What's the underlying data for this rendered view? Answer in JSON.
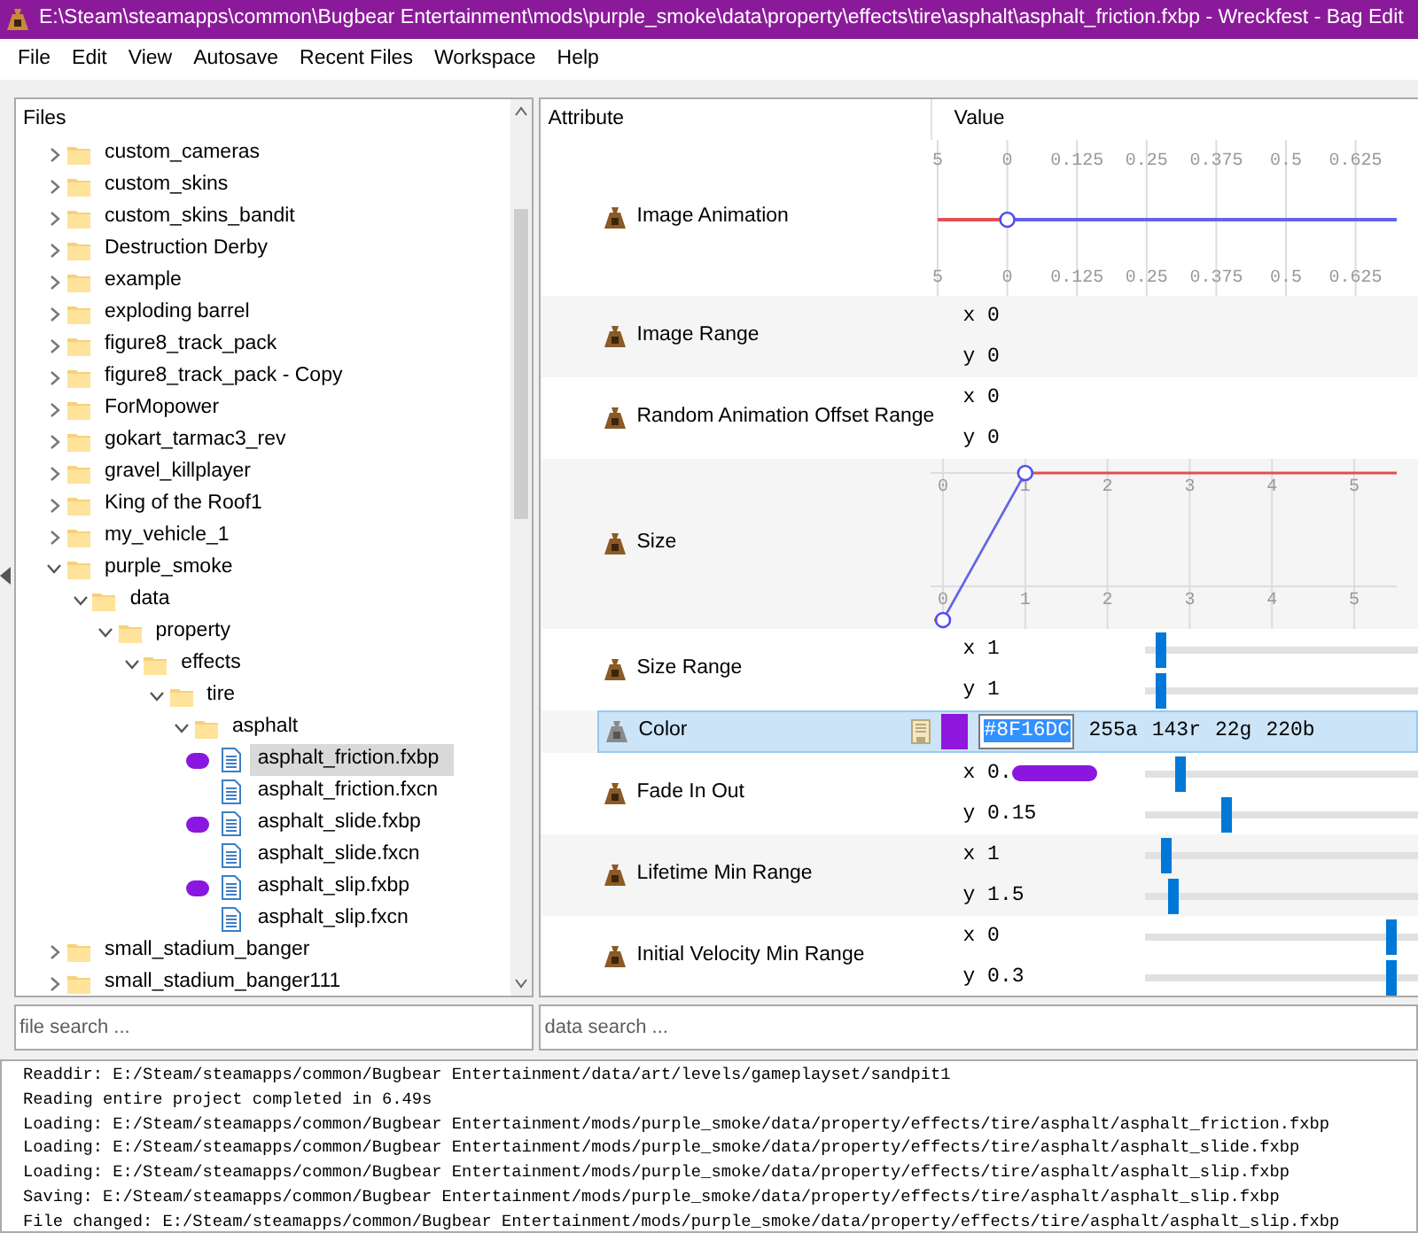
{
  "window": {
    "title": "E:\\Steam\\steamapps\\common\\Bugbear Entertainment\\mods\\purple_smoke\\data\\property\\effects\\tire\\asphalt\\asphalt_friction.fxbp - Wreckfest - Bag Edit"
  },
  "menu": [
    "File",
    "Edit",
    "View",
    "Autosave",
    "Recent Files",
    "Workspace",
    "Help"
  ],
  "files": {
    "heading": "Files",
    "search": {
      "placeholder": "file search ..."
    },
    "tree": [
      {
        "name": "custom_cameras",
        "kind": "folder",
        "expanded": false,
        "selected": false
      },
      {
        "name": "custom_skins",
        "kind": "folder",
        "expanded": false,
        "selected": false
      },
      {
        "name": "custom_skins_bandit",
        "kind": "folder",
        "expanded": false,
        "selected": false
      },
      {
        "name": "Destruction Derby",
        "kind": "folder",
        "expanded": false,
        "selected": false
      },
      {
        "name": "example",
        "kind": "folder",
        "expanded": false,
        "selected": false
      },
      {
        "name": "exploding barrel",
        "kind": "folder",
        "expanded": false,
        "selected": false
      },
      {
        "name": "figure8_track_pack",
        "kind": "folder",
        "expanded": false,
        "selected": false
      },
      {
        "name": "figure8_track_pack - Copy",
        "kind": "folder",
        "expanded": false,
        "selected": false
      },
      {
        "name": "ForMopower",
        "kind": "folder",
        "expanded": false,
        "selected": false
      },
      {
        "name": "gokart_tarmac3_rev",
        "kind": "folder",
        "expanded": false,
        "selected": false
      },
      {
        "name": "gravel_killplayer",
        "kind": "folder",
        "expanded": false,
        "selected": false
      },
      {
        "name": "King of the Roof1",
        "kind": "folder",
        "expanded": false,
        "selected": false
      },
      {
        "name": "my_vehicle_1",
        "kind": "folder",
        "expanded": false,
        "selected": false
      },
      {
        "name": "purple_smoke",
        "kind": "folder",
        "expanded": true,
        "selected": false,
        "children": [
          {
            "name": "data",
            "kind": "folder",
            "expanded": true,
            "selected": false,
            "children": [
              {
                "name": "property",
                "kind": "folder",
                "expanded": true,
                "selected": false,
                "children": [
                  {
                    "name": "effects",
                    "kind": "folder",
                    "expanded": true,
                    "selected": false,
                    "children": [
                      {
                        "name": "tire",
                        "kind": "folder",
                        "expanded": true,
                        "selected": false,
                        "children": [
                          {
                            "name": "asphalt",
                            "kind": "folder",
                            "expanded": true,
                            "selected": false,
                            "children": [
                              {
                                "name": "asphalt_friction.fxbp",
                                "kind": "file",
                                "selected": true,
                                "marked": true
                              },
                              {
                                "name": "asphalt_friction.fxcn",
                                "kind": "file",
                                "selected": false,
                                "marked": false
                              },
                              {
                                "name": "asphalt_slide.fxbp",
                                "kind": "file",
                                "selected": false,
                                "marked": true
                              },
                              {
                                "name": "asphalt_slide.fxcn",
                                "kind": "file",
                                "selected": false,
                                "marked": false
                              },
                              {
                                "name": "asphalt_slip.fxbp",
                                "kind": "file",
                                "selected": false,
                                "marked": true
                              },
                              {
                                "name": "asphalt_slip.fxcn",
                                "kind": "file",
                                "selected": false,
                                "marked": false
                              }
                            ]
                          }
                        ]
                      }
                    ]
                  }
                ]
              }
            ]
          }
        ]
      },
      {
        "name": "small_stadium_banger",
        "kind": "folder",
        "expanded": false,
        "selected": false
      },
      {
        "name": "small_stadium_banger111",
        "kind": "folder",
        "expanded": false,
        "selected": false
      }
    ]
  },
  "attributes": {
    "columns": [
      "Attribute",
      "Value"
    ],
    "search": {
      "placeholder": "data search ..."
    },
    "rows": [
      {
        "label": "Image Animation",
        "kind": "flat_curve",
        "selected": false,
        "top_ticks": [
          "5",
          "0",
          "0.125",
          "0.25",
          "0.375",
          "0.5",
          "0.625"
        ],
        "bottom_ticks": [
          "5",
          "0",
          "0.125",
          "0.25",
          "0.375",
          "0.5",
          "0.625"
        ]
      },
      {
        "label": "Image Range",
        "kind": "vector",
        "selected": false,
        "components": [
          {
            "text": "x 0"
          },
          {
            "text": "y 0"
          }
        ]
      },
      {
        "label": "Random Animation Offset Range",
        "kind": "vector",
        "selected": false,
        "components": [
          {
            "text": "x 0"
          },
          {
            "text": "y 0"
          }
        ]
      },
      {
        "label": "Size",
        "kind": "ramp_curve",
        "selected": false,
        "top_ticks": [
          "0",
          "1",
          "2",
          "3",
          "4",
          "5"
        ],
        "bottom_ticks": [
          "0",
          "1",
          "2",
          "3",
          "4",
          "5"
        ]
      },
      {
        "label": "Size Range",
        "kind": "vector",
        "selected": false,
        "components": [
          {
            "text": "x 1",
            "level": 0.04
          },
          {
            "text": "y 1",
            "level": 0.04
          }
        ]
      },
      {
        "label": "Color",
        "kind": "color",
        "selected": true,
        "color": "#8f16dc",
        "value": "#8F16DC",
        "value_selected": true,
        "channels": [
          "255a",
          "143r",
          "22g",
          "220b"
        ]
      },
      {
        "label": "Fade In Out",
        "kind": "vector",
        "selected": false,
        "components": [
          {
            "text": "x 0.",
            "marked": true,
            "level": 0.11
          },
          {
            "text": "y 0.15",
            "level": 0.28
          }
        ]
      },
      {
        "label": "Lifetime Min Range",
        "kind": "vector",
        "selected": false,
        "components": [
          {
            "text": "x 1",
            "level": 0.06
          },
          {
            "text": "y 1.5",
            "level": 0.08
          }
        ]
      },
      {
        "label": "Initial Velocity Min Range",
        "kind": "vector",
        "selected": false,
        "components": [
          {
            "text": "x 0",
            "level": 0.88
          },
          {
            "text": "y 0.3",
            "level": 0.88
          }
        ]
      }
    ]
  },
  "log": [
    "Readdir: E:/Steam/steamapps/common/Bugbear Entertainment/data/art/levels/gameplayset/sandpit1",
    "Reading entire project completed in 6.49s",
    "Loading: E:/Steam/steamapps/common/Bugbear Entertainment/mods/purple_smoke/data/property/effects/tire/asphalt/asphalt_friction.fxbp",
    "Loading: E:/Steam/steamapps/common/Bugbear Entertainment/mods/purple_smoke/data/property/effects/tire/asphalt/asphalt_slide.fxbp",
    "Loading: E:/Steam/steamapps/common/Bugbear Entertainment/mods/purple_smoke/data/property/effects/tire/asphalt/asphalt_slip.fxbp",
    "Saving: E:/Steam/steamapps/common/Bugbear Entertainment/mods/purple_smoke/data/property/effects/tire/asphalt/asphalt_slip.fxbp",
    "File changed: E:/Steam/steamapps/common/Bugbear Entertainment/mods/purple_smoke/data/property/effects/tire/asphalt/asphalt_slip.fxbp"
  ]
}
